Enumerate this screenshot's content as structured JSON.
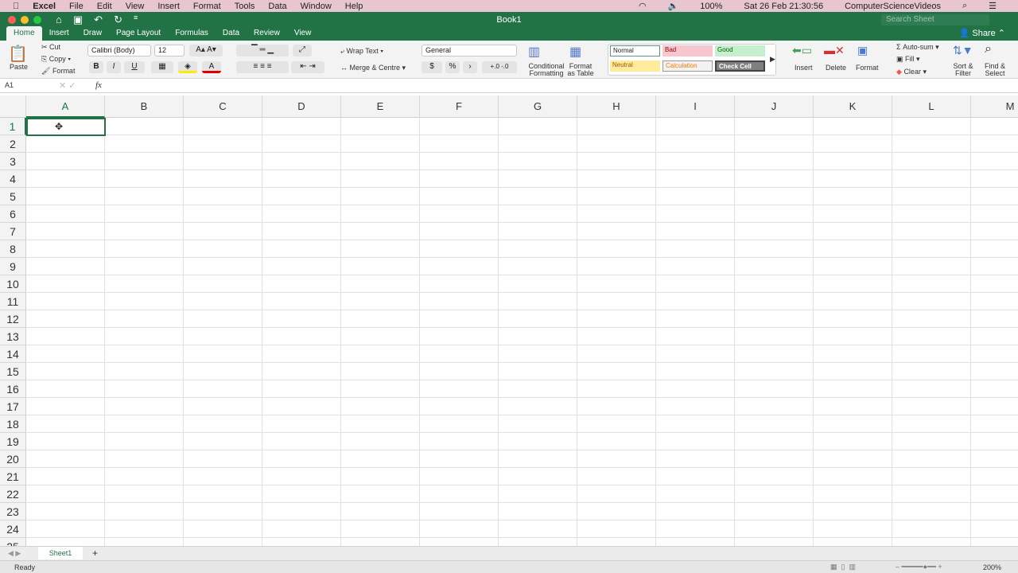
{
  "menubar": {
    "app": "Excel",
    "items": [
      "File",
      "Edit",
      "View",
      "Insert",
      "Format",
      "Tools",
      "Data",
      "Window",
      "Help"
    ],
    "battery": "100%",
    "datetime": "Sat 26 Feb  21:30:56",
    "user": "ComputerScienceVideos"
  },
  "window": {
    "title": "Book1",
    "search_placeholder": "Search Sheet",
    "share": "Share"
  },
  "tabs": [
    "Home",
    "Insert",
    "Draw",
    "Page Layout",
    "Formulas",
    "Data",
    "Review",
    "View"
  ],
  "ribbon": {
    "paste": "Paste",
    "cut": "Cut",
    "copy": "Copy",
    "format_painter": "Format",
    "font": "Calibri (Body)",
    "size": "12",
    "bold": "B",
    "italic": "I",
    "underline": "U",
    "wrap": "Wrap Text",
    "merge": "Merge & Centre",
    "number_format": "General",
    "percent": "%",
    "comma": "›",
    "cond_fmt": "Conditional Formatting",
    "fmt_table": "Format as Table",
    "styles": [
      {
        "label": "Normal",
        "bg": "#ffffff",
        "fg": "#222222"
      },
      {
        "label": "Bad",
        "bg": "#f7c6ce",
        "fg": "#9c0006"
      },
      {
        "label": "Good",
        "bg": "#c6efce",
        "fg": "#006100"
      },
      {
        "label": "Neutral",
        "bg": "#ffeb9c",
        "fg": "#9c5700"
      },
      {
        "label": "Calculation",
        "bg": "#f2f2f2",
        "fg": "#fa7d00"
      },
      {
        "label": "Check Cell",
        "bg": "#7f7f7f",
        "fg": "#ffffff"
      }
    ],
    "insert": "Insert",
    "delete": "Delete",
    "format": "Format",
    "autosum": "Auto-sum",
    "fill": "Fill",
    "clear": "Clear",
    "sort": "Sort & Filter",
    "find": "Find & Select"
  },
  "formula_bar": {
    "name_box": "A1",
    "fx": "fx",
    "value": ""
  },
  "grid": {
    "columns": [
      "A",
      "B",
      "C",
      "D",
      "E",
      "F",
      "G",
      "H",
      "I",
      "J",
      "K",
      "L",
      "M"
    ],
    "rows": 25,
    "selected": "A1"
  },
  "sheets": {
    "tabs": [
      "Sheet1"
    ],
    "add": "+"
  },
  "status": {
    "text": "Ready",
    "zoom": "200%"
  },
  "colors": {
    "accent": "#217346"
  }
}
